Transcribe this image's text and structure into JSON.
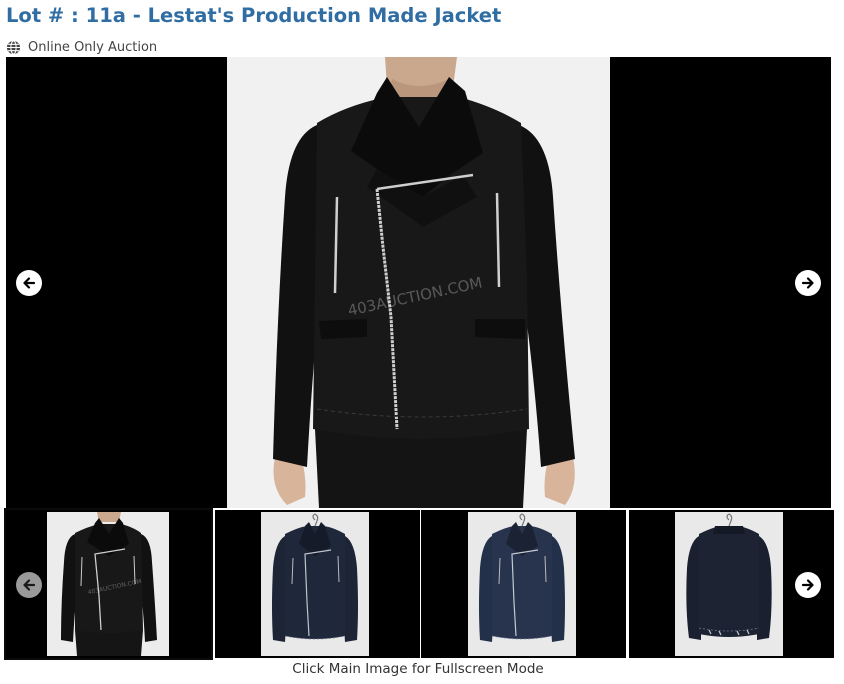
{
  "lot": {
    "title": "Lot # : 11a - Lestat's Production Made Jacket",
    "auction_type": "Online Only Auction",
    "auction_type_icon": "globe-icon"
  },
  "gallery": {
    "main_image_alt": "Lestat's Production Made Jacket",
    "watermark": "403AUCTION.COM",
    "prev_icon": "arrow-left-icon",
    "next_icon": "arrow-right-icon",
    "thumbnails": [
      {
        "alt": "Jacket worn by model, front view",
        "active": true
      },
      {
        "alt": "Jacket on hanger, front view"
      },
      {
        "alt": "Jacket on hanger, front view"
      },
      {
        "alt": "Jacket on hanger, back view"
      }
    ],
    "caption": "Click Main Image for Fullscreen Mode"
  },
  "colors": {
    "title": "#2f6da3",
    "viewer_background": "#000000",
    "jacket": "#151515",
    "hanger_jacket": "#1c2436"
  }
}
